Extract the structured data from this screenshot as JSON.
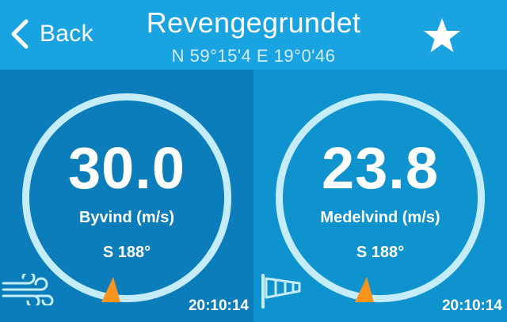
{
  "header": {
    "back_label": "Back",
    "title": "Revengegrundet",
    "coordinates": "N 59°15'4 E 19°0'46",
    "favorite_icon": "star-icon"
  },
  "gauges": [
    {
      "value": "30.0",
      "label": "Byvind (m/s)",
      "direction": "S 188°",
      "time": "20:10:14",
      "icon": "wind-gust-icon"
    },
    {
      "value": "23.8",
      "label": "Medelvind (m/s)",
      "direction": "S 188°",
      "time": "20:10:14",
      "icon": "windsock-icon"
    }
  ],
  "colors": {
    "header": "#19a3e0",
    "left_panel": "#0c7dbb",
    "right_panel": "#0f93ce",
    "ring": "#c4ecfb",
    "needle": "#f7941d"
  }
}
